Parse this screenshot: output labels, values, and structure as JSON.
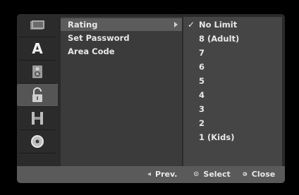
{
  "iconbar": {
    "icons": [
      {
        "name": "disc-settings-icon",
        "selected": false
      },
      {
        "name": "language-icon",
        "label": "A",
        "selected": false
      },
      {
        "name": "audio-speaker-icon",
        "selected": false
      },
      {
        "name": "lock-icon",
        "selected": true
      },
      {
        "name": "film-icon",
        "selected": false
      },
      {
        "name": "disc-icon",
        "selected": false
      }
    ]
  },
  "menu": {
    "items": [
      {
        "label": "Rating",
        "active": true
      },
      {
        "label": "Set Password",
        "active": false
      },
      {
        "label": "Area Code",
        "active": false
      }
    ]
  },
  "options": {
    "items": [
      {
        "label": "No Limit",
        "checked": true
      },
      {
        "label": "8 (Adult)",
        "checked": false
      },
      {
        "label": "7",
        "checked": false
      },
      {
        "label": "6",
        "checked": false
      },
      {
        "label": "5",
        "checked": false
      },
      {
        "label": "4",
        "checked": false
      },
      {
        "label": "3",
        "checked": false
      },
      {
        "label": "2",
        "checked": false
      },
      {
        "label": "1 (Kids)",
        "checked": false
      }
    ],
    "check_glyph": "✓"
  },
  "bottombar": {
    "prev_glyph": "◂",
    "prev_label": "Prev.",
    "select_glyph": "⊙",
    "select_label": "Select",
    "close_glyph": "ǝ",
    "close_label": "Close"
  }
}
